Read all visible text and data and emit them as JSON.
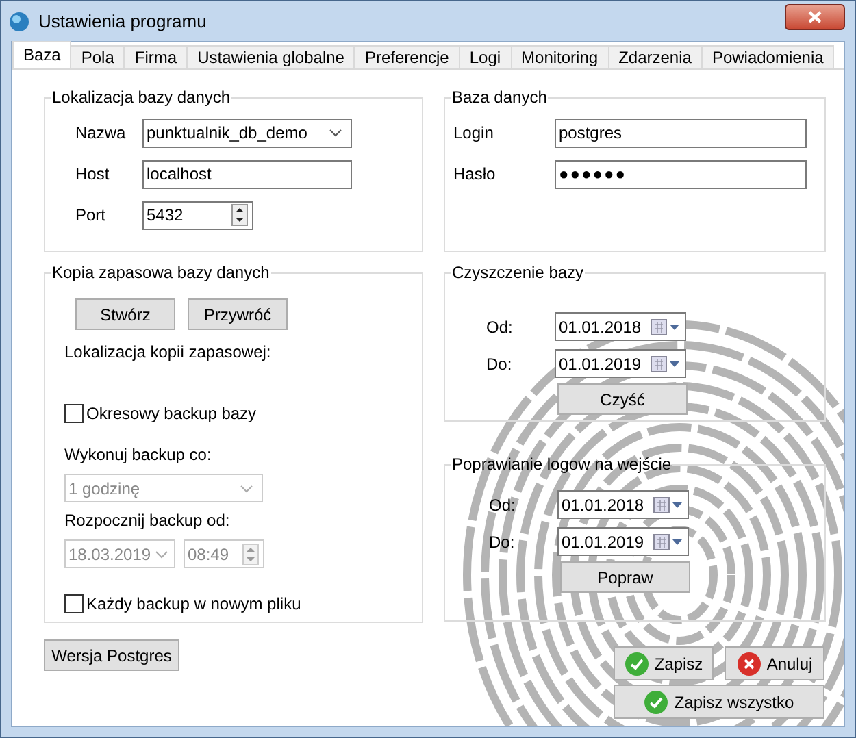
{
  "window": {
    "title": "Ustawienia programu"
  },
  "tabs": [
    {
      "label": "Baza",
      "selected": true
    },
    {
      "label": "Pola",
      "selected": false
    },
    {
      "label": "Firma",
      "selected": false
    },
    {
      "label": "Ustawienia globalne",
      "selected": false
    },
    {
      "label": "Preferencje",
      "selected": false
    },
    {
      "label": "Logi",
      "selected": false
    },
    {
      "label": "Monitoring",
      "selected": false
    },
    {
      "label": "Zdarzenia",
      "selected": false
    },
    {
      "label": "Powiadomienia",
      "selected": false
    }
  ],
  "db_location": {
    "title": "Lokalizacja bazy danych",
    "fields": [
      {
        "label": "Nazwa",
        "kind": "combo",
        "value": "punktualnik_db_demo"
      },
      {
        "label": "Host",
        "kind": "text",
        "value": "localhost"
      },
      {
        "label": "Port",
        "kind": "spin",
        "value": "5432"
      }
    ]
  },
  "database": {
    "title": "Baza danych",
    "fields": [
      {
        "label": "Login",
        "kind": "text",
        "value": "postgres"
      },
      {
        "label": "Hasło",
        "kind": "password",
        "value": "●●●●●●"
      }
    ]
  },
  "backup": {
    "title": "Kopia zapasowa bazy danych",
    "buttons": [
      "Stwórz",
      "Przywróć"
    ],
    "location_label": "Lokalizacja kopii zapasowej:",
    "periodic": {
      "label": "Okresowy backup bazy",
      "checked": false
    },
    "interval_label": "Wykonuj backup co:",
    "interval": {
      "value": "1 godzinę",
      "disabled": true
    },
    "start_label": "Rozpocznij backup od:",
    "start_date": {
      "value": "18.03.2019",
      "disabled": true
    },
    "start_time": {
      "value": "08:49",
      "disabled": true
    },
    "new_file": {
      "label": "Każdy backup w nowym pliku",
      "checked": false
    }
  },
  "cleanup": {
    "title": "Czyszczenie bazy",
    "from_label": "Od:",
    "from": "01.01.2018",
    "to_label": "Do:",
    "to": "01.01.2019",
    "button": "Czyść"
  },
  "log_fix": {
    "title": "Poprawianie logow na wejście",
    "from_label": "Od:",
    "from": "01.01.2018",
    "to_label": "Do:",
    "to": "01.01.2019",
    "button": "Popraw"
  },
  "postgres_button": "Wersja Postgres",
  "actions": [
    {
      "label": "Zapisz",
      "kind": "ok"
    },
    {
      "label": "Anuluj",
      "kind": "cancel"
    },
    {
      "label": "Zapisz wszystko",
      "kind": "ok"
    }
  ]
}
